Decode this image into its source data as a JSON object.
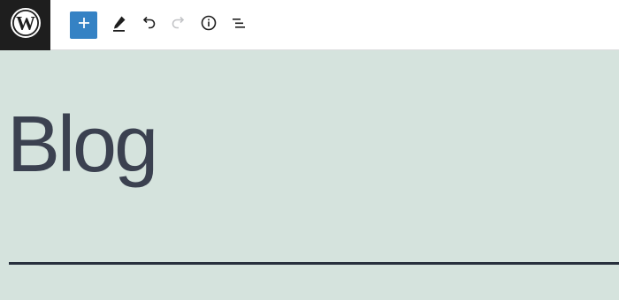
{
  "toolbar": {
    "logo_icon": "wordpress-logo-icon",
    "tools": [
      {
        "name": "add-block-button",
        "icon": "plus-icon"
      },
      {
        "name": "edit-tool-button",
        "icon": "pencil-icon"
      },
      {
        "name": "undo-button",
        "icon": "undo-icon"
      },
      {
        "name": "redo-button",
        "icon": "redo-icon",
        "disabled": true
      },
      {
        "name": "details-button",
        "icon": "info-icon"
      },
      {
        "name": "list-view-button",
        "icon": "list-view-icon"
      }
    ]
  },
  "content": {
    "title": "Blog"
  },
  "colors": {
    "canvas_background": "#d5e3dd",
    "toolbar_background": "#ffffff",
    "logo_background": "#1e1e1e",
    "inserter_background": "#3582c4",
    "title_color": "#3b4150",
    "separator_color": "#28303d",
    "disabled_icon": "#c3c4c7"
  }
}
